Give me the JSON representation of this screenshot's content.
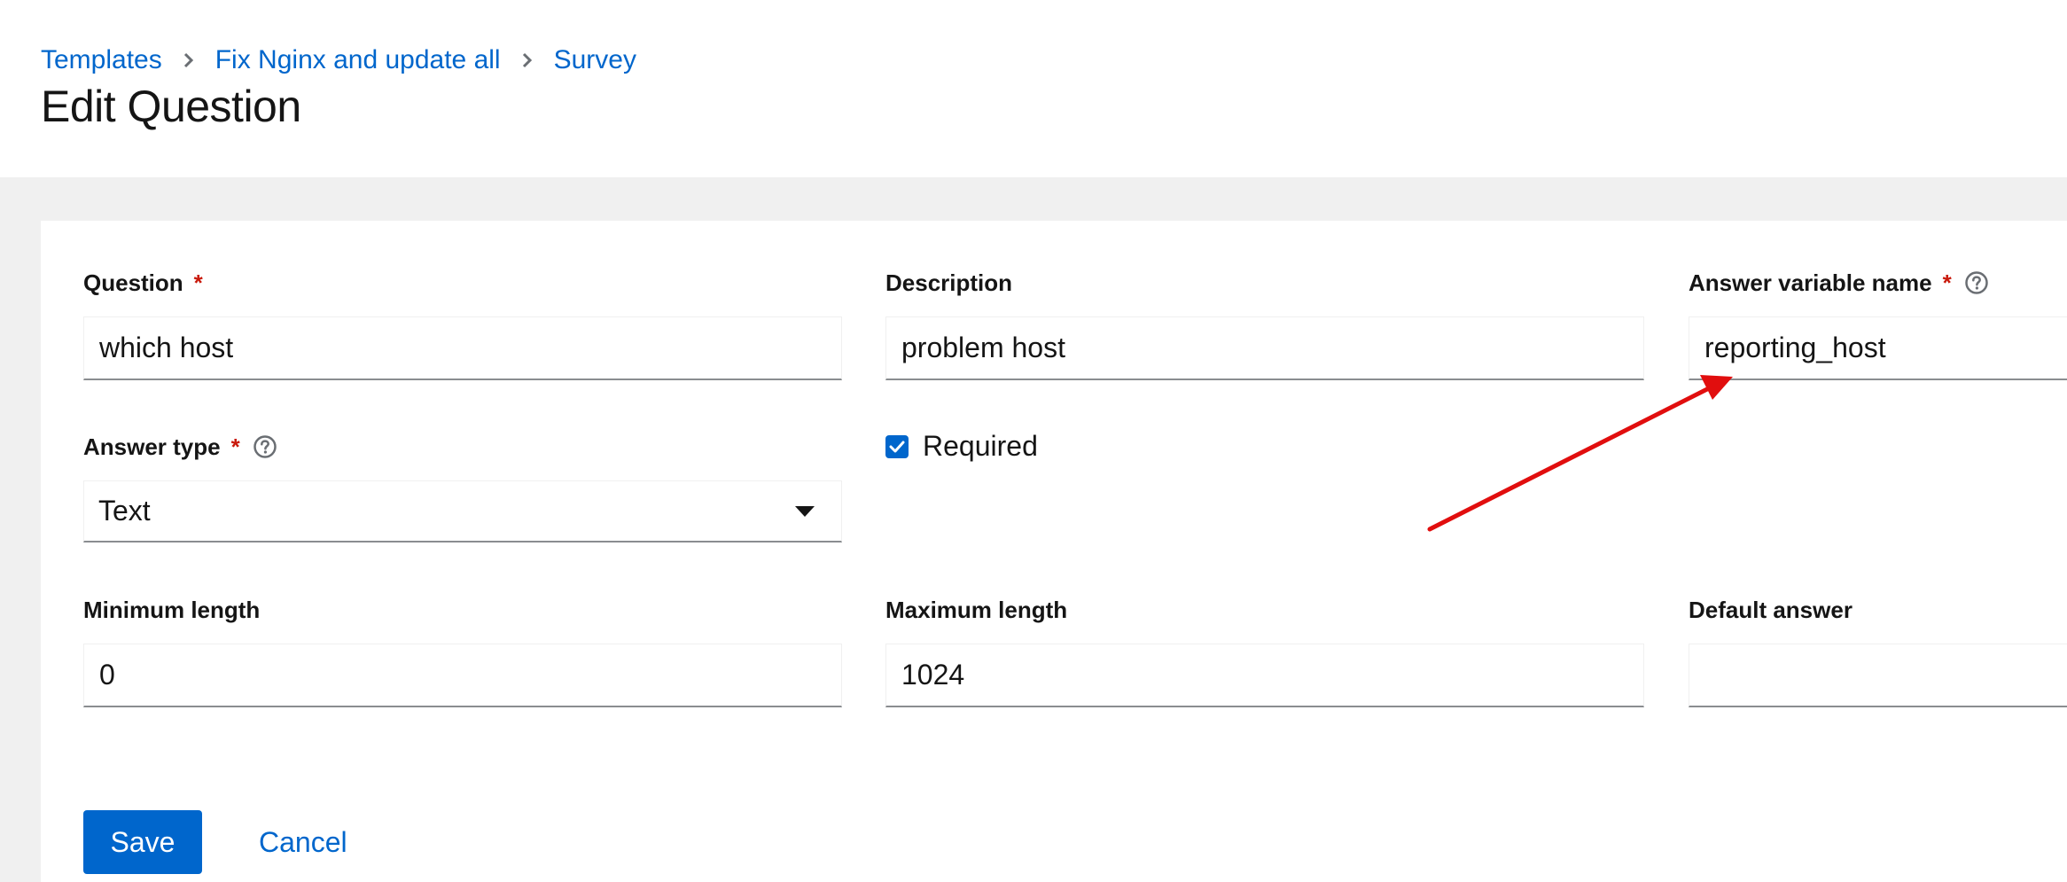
{
  "breadcrumb": {
    "items": [
      "Templates",
      "Fix Nginx and update all",
      "Survey"
    ]
  },
  "page": {
    "title": "Edit Question"
  },
  "form": {
    "question": {
      "label": "Question",
      "required_mark": "*",
      "value": "which host"
    },
    "description": {
      "label": "Description",
      "value": "problem host"
    },
    "variable": {
      "label": "Answer variable name",
      "required_mark": "*",
      "value": "reporting_host"
    },
    "answer_type": {
      "label": "Answer type",
      "required_mark": "*",
      "value": "Text"
    },
    "required": {
      "label": "Required",
      "checked": true
    },
    "min_length": {
      "label": "Minimum length",
      "value": "0"
    },
    "max_length": {
      "label": "Maximum length",
      "value": "1024"
    },
    "default_answer": {
      "label": "Default answer",
      "value": ""
    }
  },
  "actions": {
    "save": "Save",
    "cancel": "Cancel"
  },
  "icons": {
    "breadcrumb_separator": "chevron-right-icon",
    "help": "question-circle-icon",
    "select_toggle": "caret-down-icon",
    "checkbox": "check-icon"
  },
  "colors": {
    "link": "#0066cc",
    "primary_button": "#0066cc",
    "required_mark": "#c9190b",
    "annotation_arrow": "#e10e0e",
    "page_background": "#f0f0f0"
  }
}
